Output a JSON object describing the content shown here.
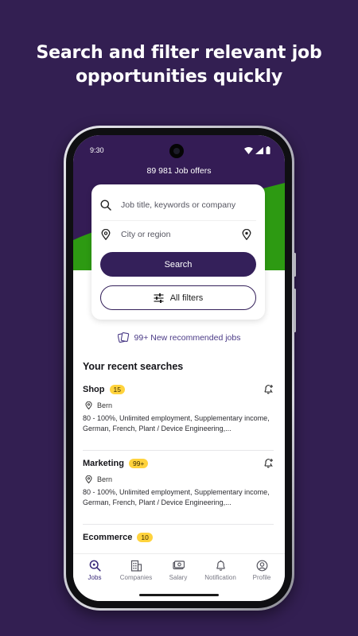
{
  "headline": {
    "line1": "Search and filter relevant job",
    "line2": "opportunities quickly"
  },
  "status_bar": {
    "time": "9:30"
  },
  "header": {
    "job_offers": "89 981 Job offers"
  },
  "search": {
    "keyword_placeholder": "Job title, keywords or company",
    "location_placeholder": "City or region",
    "search_button": "Search",
    "filters_button": "All filters"
  },
  "recommended": {
    "label": "99+ New recommended jobs"
  },
  "recent": {
    "title": "Your recent searches",
    "items": [
      {
        "title": "Shop",
        "count": "15",
        "location": "Bern",
        "description": "80 - 100%, Unlimited employment, Supplementary income, German, French, Plant / Device Engineering,..."
      },
      {
        "title": "Marketing",
        "count": "99+",
        "location": "Bern",
        "description": "80 - 100%, Unlimited employment, Supplementary income, German, French, Plant / Device Engineering,..."
      },
      {
        "title": "Ecommerce",
        "count": "10",
        "location": "",
        "description": ""
      }
    ]
  },
  "nav": {
    "items": [
      {
        "label": "Jobs",
        "icon": "search-icon"
      },
      {
        "label": "Companies",
        "icon": "building-icon"
      },
      {
        "label": "Salary",
        "icon": "money-icon"
      },
      {
        "label": "Notification",
        "icon": "bell-icon"
      },
      {
        "label": "Profile",
        "icon": "profile-icon"
      }
    ],
    "active": "Jobs"
  },
  "colors": {
    "background": "#331f52",
    "brand_purple": "#34205a",
    "accent_green": "#2d9a12",
    "badge_yellow": "#ffd33d"
  }
}
